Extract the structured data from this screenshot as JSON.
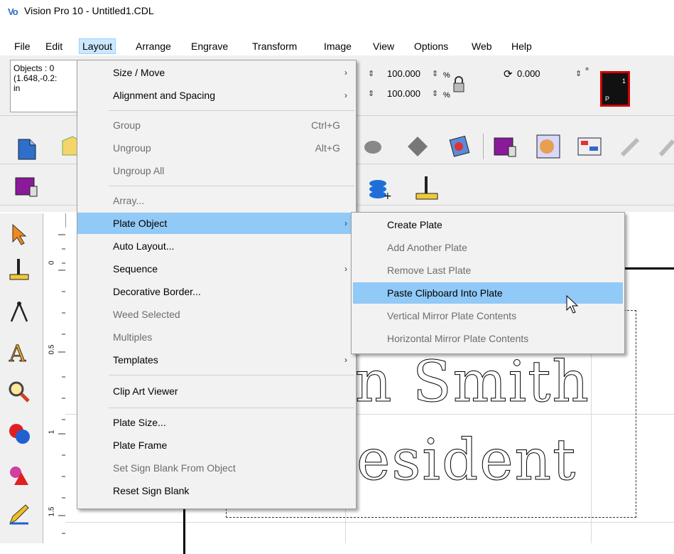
{
  "window": {
    "title": "Vision Pro 10 - Untitled1.CDL",
    "logo_text": "Vo"
  },
  "menubar": [
    "File",
    "Edit",
    "Layout",
    "Arrange",
    "Engrave",
    "Transform",
    "Image",
    "View",
    "Options",
    "Web",
    "Help"
  ],
  "props": {
    "line1": "Objects : 0",
    "line2": "(1.648,-0.2:",
    "line3": "in"
  },
  "scale": {
    "x": "100.000",
    "y": "100.000",
    "unit": "%",
    "rotate": "0.000",
    "deg": "°",
    "swatch_label_top": "1",
    "swatch_label_bottom": "P"
  },
  "layout_menu": {
    "items": [
      {
        "label": "Size / Move",
        "shortcut": "",
        "submenu": true,
        "disabled": false
      },
      {
        "label": "Alignment and Spacing",
        "shortcut": "",
        "submenu": true,
        "disabled": false
      },
      {
        "label": "Group",
        "shortcut": "Ctrl+G",
        "submenu": false,
        "disabled": true
      },
      {
        "label": "Ungroup",
        "shortcut": "Alt+G",
        "submenu": false,
        "disabled": true
      },
      {
        "label": "Ungroup All",
        "shortcut": "",
        "submenu": false,
        "disabled": true
      },
      {
        "label": "Array...",
        "shortcut": "",
        "submenu": false,
        "disabled": true
      },
      {
        "label": "Plate Object",
        "shortcut": "",
        "submenu": true,
        "disabled": false,
        "highlighted": true
      },
      {
        "label": "Auto Layout...",
        "shortcut": "",
        "submenu": false,
        "disabled": false
      },
      {
        "label": "Sequence",
        "shortcut": "",
        "submenu": true,
        "disabled": false
      },
      {
        "label": "Decorative Border...",
        "shortcut": "",
        "submenu": false,
        "disabled": false
      },
      {
        "label": "Weed Selected",
        "shortcut": "",
        "submenu": false,
        "disabled": true
      },
      {
        "label": "Multiples",
        "shortcut": "",
        "submenu": false,
        "disabled": true
      },
      {
        "label": "Templates",
        "shortcut": "",
        "submenu": true,
        "disabled": false
      },
      {
        "label": "Clip Art Viewer",
        "shortcut": "",
        "submenu": false,
        "disabled": false
      },
      {
        "label": "Plate Size...",
        "shortcut": "",
        "submenu": false,
        "disabled": false
      },
      {
        "label": "Plate Frame",
        "shortcut": "",
        "submenu": false,
        "disabled": false
      },
      {
        "label": "Set Sign Blank From Object",
        "shortcut": "",
        "submenu": false,
        "disabled": true
      },
      {
        "label": "Reset Sign Blank",
        "shortcut": "",
        "submenu": false,
        "disabled": false
      }
    ]
  },
  "plate_submenu": {
    "items": [
      {
        "label": "Create Plate",
        "disabled": false
      },
      {
        "label": "Add Another Plate",
        "disabled": true
      },
      {
        "label": "Remove Last Plate",
        "disabled": true
      },
      {
        "label": "Paste Clipboard Into Plate",
        "disabled": false,
        "highlighted": true
      },
      {
        "label": "Vertical Mirror Plate Contents",
        "disabled": true
      },
      {
        "label": "Horizontal Mirror Plate Contents",
        "disabled": true
      }
    ]
  },
  "canvas": {
    "line1": "n Smith",
    "line2": "esident"
  },
  "ruler": {
    "marks": [
      "0",
      "0.5",
      "1",
      "1.5"
    ]
  }
}
